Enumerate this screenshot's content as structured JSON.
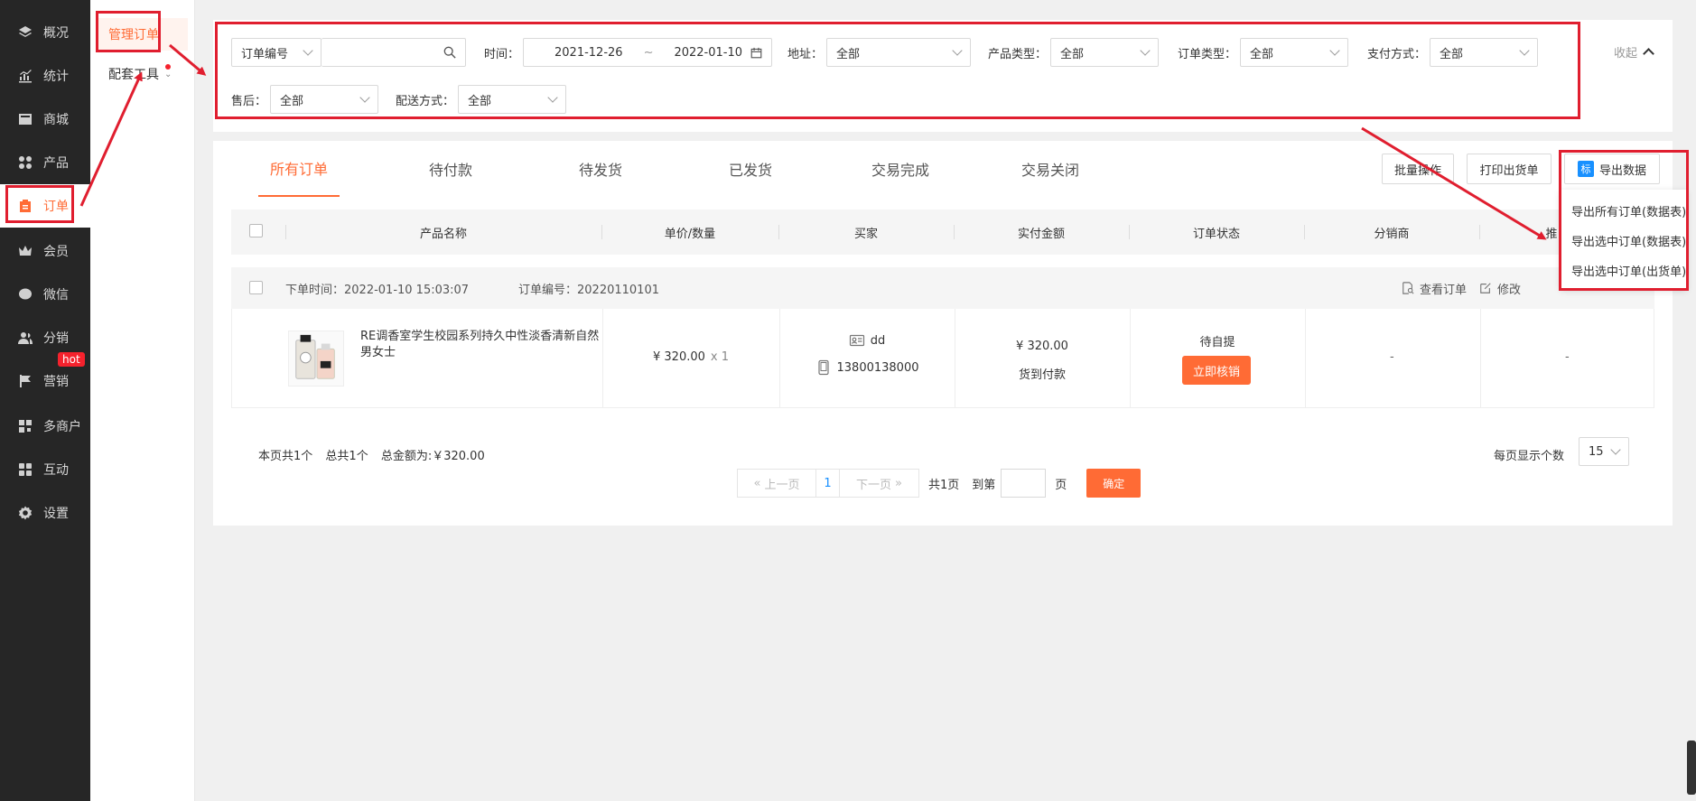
{
  "sidebar": {
    "items": [
      {
        "label": "概况",
        "icon": "layers-icon"
      },
      {
        "label": "统计",
        "icon": "chart-icon"
      },
      {
        "label": "商城",
        "icon": "store-icon"
      },
      {
        "label": "产品",
        "icon": "grid-icon"
      },
      {
        "label": "订单",
        "icon": "clipboard-icon"
      },
      {
        "label": "会员",
        "icon": "crown-icon"
      },
      {
        "label": "微信",
        "icon": "wechat-icon"
      },
      {
        "label": "分销",
        "icon": "users-icon"
      },
      {
        "label": "营销",
        "icon": "flag-icon"
      },
      {
        "label": "多商户",
        "icon": "building-icon"
      },
      {
        "label": "互动",
        "icon": "apps-icon"
      },
      {
        "label": "设置",
        "icon": "gear-icon"
      }
    ],
    "hot_badge": "hot"
  },
  "submenu": {
    "items": [
      {
        "label": "管理订单"
      },
      {
        "label": "配套工具"
      }
    ]
  },
  "filters": {
    "search_type": "订单编号",
    "search_value": "",
    "time_label": "时间：",
    "date_start": "2021-12-26",
    "date_sep": "~",
    "date_end": "2022-01-10",
    "address_label": "地址：",
    "address_value": "全部",
    "product_type_label": "产品类型：",
    "product_type_value": "全部",
    "order_type_label": "订单类型：",
    "order_type_value": "全部",
    "payment_label": "支付方式：",
    "payment_value": "全部",
    "aftersale_label": "售后：",
    "aftersale_value": "全部",
    "delivery_label": "配送方式：",
    "delivery_value": "全部",
    "collapse_label": "收起"
  },
  "tabs": [
    {
      "label": "所有订单"
    },
    {
      "label": "待付款"
    },
    {
      "label": "待发货"
    },
    {
      "label": "已发货"
    },
    {
      "label": "交易完成"
    },
    {
      "label": "交易关闭"
    }
  ],
  "toolbar": {
    "batch_label": "批量操作",
    "print_label": "打印出货单",
    "export_tag": "标",
    "export_label": "导出数据"
  },
  "export_menu": [
    "导出所有订单(数据表)",
    "导出选中订单(数据表)",
    "导出选中订单(出货单)"
  ],
  "table": {
    "columns": [
      "产品名称",
      "单价/数量",
      "买家",
      "实付金额",
      "订单状态",
      "分销商",
      "推"
    ]
  },
  "order": {
    "time": "下单时间：2022-01-10 15:03:07",
    "number": "订单编号：20220110101",
    "view_label": "查看订单",
    "edit_label": "修改",
    "product_name": "RE调香室学生校园系列持久中性淡香清新自然男女士",
    "price": "¥ 320.00",
    "qty": "x 1",
    "buyer_name": "dd",
    "buyer_phone": "13800138000",
    "paid_amount": "¥ 320.00",
    "pay_method": "货到付款",
    "status": "待自提",
    "verify_label": "立即核销",
    "distributor": "-",
    "promoter": "-"
  },
  "summary": {
    "page_count": "本页共1个",
    "total_count": "总共1个",
    "total_amount": "总金额为:￥320.00"
  },
  "pagination": {
    "prev": "上一页",
    "current": "1",
    "next": "下一页",
    "total_pages": "共1页",
    "goto_label": "到第",
    "page_unit": "页",
    "confirm": "确定",
    "per_page_label": "每页显示个数",
    "per_page_value": "15"
  },
  "colors": {
    "accent": "#ff6b35",
    "annotation": "#e01e2f",
    "sidebar_bg": "#262626"
  }
}
